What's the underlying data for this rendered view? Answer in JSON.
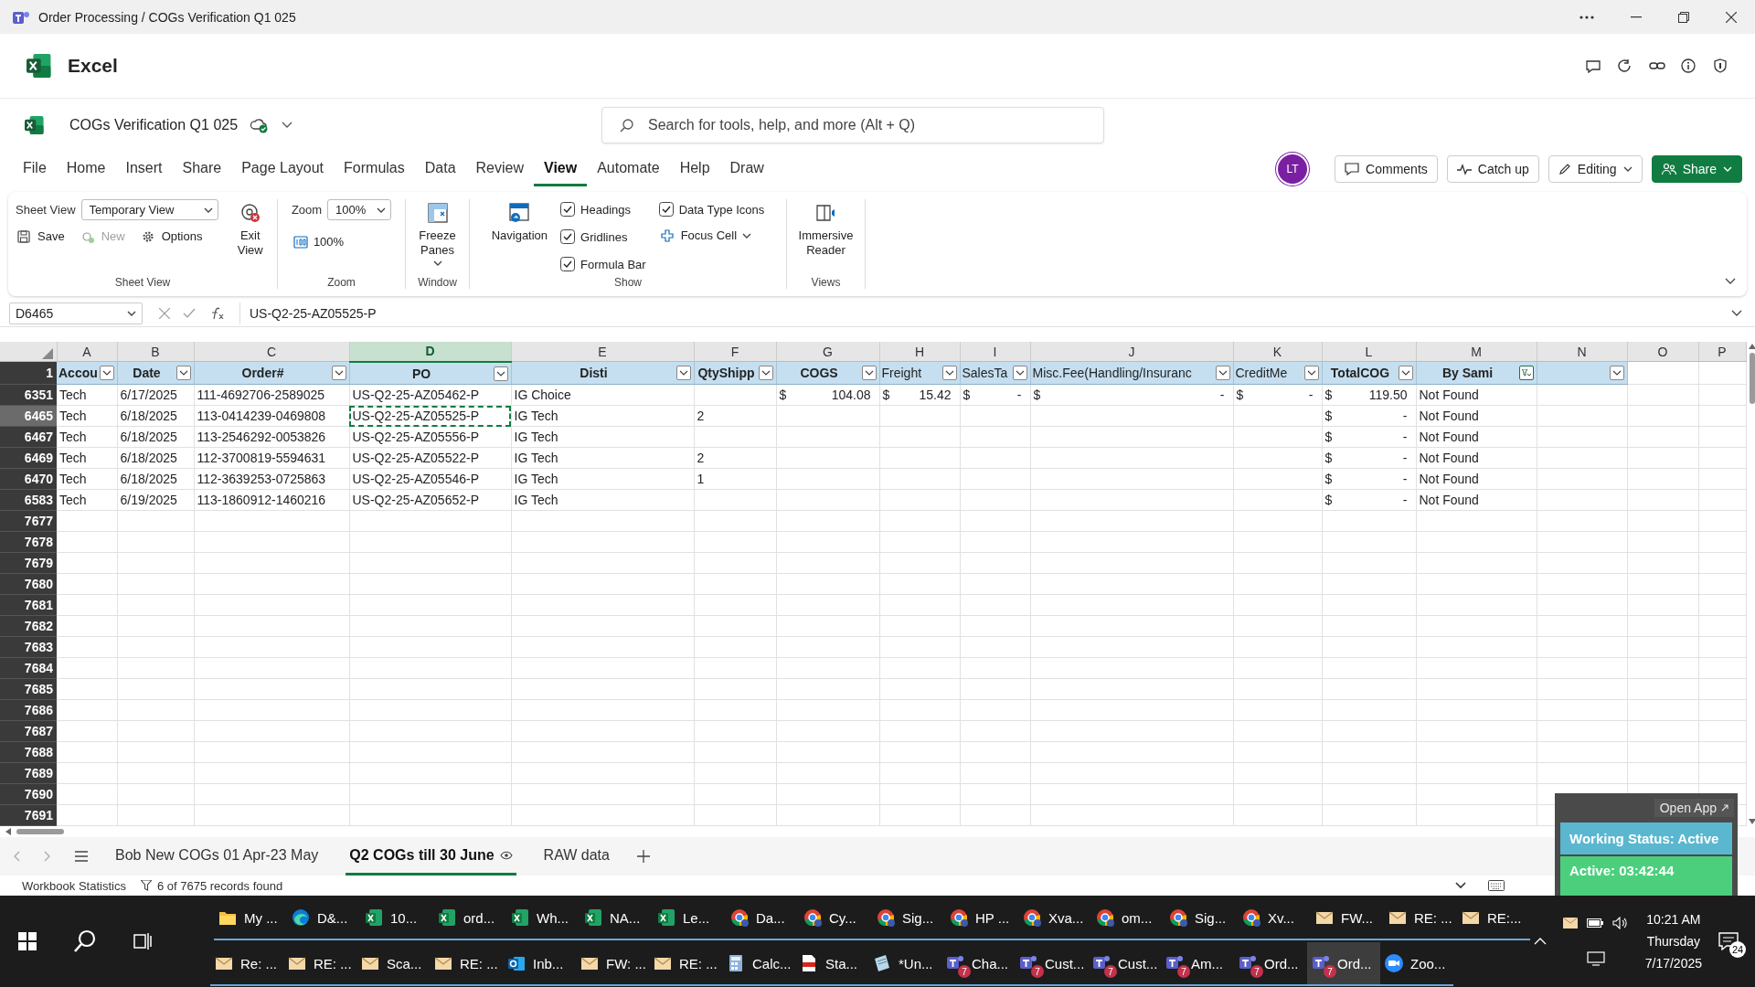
{
  "window": {
    "title": "Order Processing / COGs Verification Q1 025"
  },
  "app": {
    "name": "Excel"
  },
  "document": {
    "name": "COGs Verification Q1 025"
  },
  "search": {
    "placeholder": "Search for tools, help, and more (Alt + Q)"
  },
  "menu_tabs": [
    {
      "label": "File",
      "selected": false
    },
    {
      "label": "Home",
      "selected": false
    },
    {
      "label": "Insert",
      "selected": false
    },
    {
      "label": "Share",
      "selected": false
    },
    {
      "label": "Page Layout",
      "selected": false
    },
    {
      "label": "Formulas",
      "selected": false
    },
    {
      "label": "Data",
      "selected": false
    },
    {
      "label": "Review",
      "selected": false
    },
    {
      "label": "View",
      "selected": true
    },
    {
      "label": "Automate",
      "selected": false
    },
    {
      "label": "Help",
      "selected": false
    },
    {
      "label": "Draw",
      "selected": false
    }
  ],
  "avatar": {
    "initials": "LT"
  },
  "header_buttons": [
    {
      "label": "Comments",
      "kind": "plain"
    },
    {
      "label": "Catch up",
      "kind": "plain"
    },
    {
      "label": "Editing",
      "kind": "menu"
    },
    {
      "label": "Share",
      "kind": "primary"
    }
  ],
  "ribbon": {
    "groups": [
      {
        "label": "Sheet View",
        "columns": [
          [
            {
              "kind": "select",
              "label": "Sheet View",
              "value": "Temporary View"
            },
            {
              "kind": "row",
              "items": [
                {
                  "label": "Save",
                  "disabled": false
                },
                {
                  "label": "New",
                  "disabled": true
                },
                {
                  "label": "Options",
                  "disabled": false
                }
              ]
            }
          ],
          [
            {
              "kind": "big",
              "label": "Exit View",
              "menu": false
            }
          ]
        ]
      },
      {
        "label": "Zoom",
        "columns": [
          [
            {
              "kind": "select",
              "label": "Zoom",
              "value": "100%"
            },
            {
              "kind": "small",
              "label": "100%",
              "disabled": false,
              "menu": false
            }
          ]
        ]
      },
      {
        "label": "Window",
        "columns": [
          [
            {
              "kind": "big",
              "label": "Freeze Panes",
              "menu": true
            }
          ]
        ]
      },
      {
        "label": "Show",
        "columns": [
          [
            {
              "kind": "big",
              "label": "Navigation",
              "menu": false
            }
          ],
          [
            {
              "kind": "check",
              "label": "Headings",
              "checked": true
            },
            {
              "kind": "check",
              "label": "Gridlines",
              "checked": true
            },
            {
              "kind": "check",
              "label": "Formula Bar",
              "checked": true
            }
          ],
          [
            {
              "kind": "check",
              "label": "Data Type Icons",
              "checked": true
            },
            {
              "kind": "small",
              "label": "Focus Cell",
              "disabled": false,
              "menu": true
            }
          ]
        ]
      },
      {
        "label": "Views",
        "columns": [
          [
            {
              "kind": "big",
              "label": "Immersive Reader",
              "menu": false
            }
          ]
        ]
      }
    ]
  },
  "formula_bar": {
    "name_box": "D6465",
    "value": "US-Q2-25-AZ05525-P"
  },
  "grid": {
    "columns": [
      {
        "letter": "A",
        "selected": false
      },
      {
        "letter": "B",
        "selected": false
      },
      {
        "letter": "C",
        "selected": false
      },
      {
        "letter": "D",
        "selected": true
      },
      {
        "letter": "E",
        "selected": false
      },
      {
        "letter": "F",
        "selected": false
      },
      {
        "letter": "G",
        "selected": false
      },
      {
        "letter": "H",
        "selected": false
      },
      {
        "letter": "I",
        "selected": false
      },
      {
        "letter": "J",
        "selected": false
      },
      {
        "letter": "K",
        "selected": false
      },
      {
        "letter": "L",
        "selected": false
      },
      {
        "letter": "M",
        "selected": false
      },
      {
        "letter": "N",
        "selected": false
      },
      {
        "letter": "O",
        "selected": false
      },
      {
        "letter": "P",
        "selected": false
      }
    ],
    "header_row": {
      "number": "1",
      "cells": [
        {
          "label": "Accou",
          "filtered": false
        },
        {
          "label": "Date",
          "filtered": false
        },
        {
          "label": "Order#",
          "filtered": false
        },
        {
          "label": "PO",
          "filtered": false
        },
        {
          "label": "Disti",
          "filtered": false
        },
        {
          "label": "QtyShipp",
          "filtered": false
        },
        {
          "label": "COGS",
          "filtered": false
        },
        {
          "label": "Freight",
          "filtered": false
        },
        {
          "label": "SalesTa",
          "filtered": false
        },
        {
          "label": "Misc.Fee(Handling/Insuranc",
          "filtered": false
        },
        {
          "label": "CreditMe",
          "filtered": false
        },
        {
          "label": "TotalCOG",
          "filtered": false
        },
        {
          "label": "By Sami",
          "filtered": true
        },
        {
          "filtered": false
        }
      ]
    },
    "rows": [
      {
        "number": "6351",
        "selected": false,
        "cells": {
          "A": "Tech",
          "B": "6/17/2025",
          "C": "111-4692706-2589025",
          "D": "US-Q2-25-AZ05462-P",
          "E": "IG Choice",
          "G": {
            "currency": "$",
            "amount": "104.08"
          },
          "H": {
            "currency": "$",
            "amount": "15.42"
          },
          "I": {
            "currency": "$",
            "amount": "-"
          },
          "J": {
            "currency": "$",
            "amount": "-"
          },
          "K": {
            "currency": "$",
            "amount": "-"
          },
          "L": {
            "currency": "$",
            "amount": "119.50"
          },
          "M": "Not Found"
        }
      },
      {
        "number": "6465",
        "selected": true,
        "cells": {
          "A": "Tech",
          "B": "6/18/2025",
          "C": "113-0414239-0469808",
          "D": "US-Q2-25-AZ05525-P",
          "E": "IG Tech",
          "F": "2",
          "L": {
            "currency": "$",
            "amount": "-"
          },
          "M": "Not Found"
        }
      },
      {
        "number": "6467",
        "selected": false,
        "cells": {
          "A": "Tech",
          "B": "6/18/2025",
          "C": "113-2546292-0053826",
          "D": "US-Q2-25-AZ05556-P",
          "E": "IG Tech",
          "L": {
            "currency": "$",
            "amount": "-"
          },
          "M": "Not Found"
        }
      },
      {
        "number": "6469",
        "selected": false,
        "cells": {
          "A": "Tech",
          "B": "6/18/2025",
          "C": "112-3700819-5594631",
          "D": "US-Q2-25-AZ05522-P",
          "E": "IG Tech",
          "F": "2",
          "L": {
            "currency": "$",
            "amount": "-"
          },
          "M": "Not Found"
        }
      },
      {
        "number": "6470",
        "selected": false,
        "cells": {
          "A": "Tech",
          "B": "6/18/2025",
          "C": "112-3639253-0725863",
          "D": "US-Q2-25-AZ05546-P",
          "E": "IG Tech",
          "F": "1",
          "L": {
            "currency": "$",
            "amount": "-"
          },
          "M": "Not Found"
        }
      },
      {
        "number": "6583",
        "selected": false,
        "cells": {
          "A": "Tech",
          "B": "6/19/2025",
          "C": "113-1860912-1460216",
          "D": "US-Q2-25-AZ05652-P",
          "E": "IG Tech",
          "L": {
            "currency": "$",
            "amount": "-"
          },
          "M": "Not Found"
        }
      },
      {
        "number": "7677",
        "selected": false,
        "cells": {}
      },
      {
        "number": "7678",
        "selected": false,
        "cells": {}
      },
      {
        "number": "7679",
        "selected": false,
        "cells": {}
      },
      {
        "number": "7680",
        "selected": false,
        "cells": {}
      },
      {
        "number": "7681",
        "selected": false,
        "cells": {}
      },
      {
        "number": "7682",
        "selected": false,
        "cells": {}
      },
      {
        "number": "7683",
        "selected": false,
        "cells": {}
      },
      {
        "number": "7684",
        "selected": false,
        "cells": {}
      },
      {
        "number": "7685",
        "selected": false,
        "cells": {}
      },
      {
        "number": "7686",
        "selected": false,
        "cells": {}
      },
      {
        "number": "7687",
        "selected": false,
        "cells": {}
      },
      {
        "number": "7688",
        "selected": false,
        "cells": {}
      },
      {
        "number": "7689",
        "selected": false,
        "cells": {}
      },
      {
        "number": "7690",
        "selected": false,
        "cells": {}
      },
      {
        "number": "7691",
        "selected": false,
        "cells": {}
      }
    ]
  },
  "sheet_tabs": [
    {
      "label": "Bob New COGs 01 Apr-23 May",
      "selected": false
    },
    {
      "label": "Q2 COGs till 30 June",
      "selected": true
    },
    {
      "label": "RAW data",
      "selected": false
    }
  ],
  "status_bar": {
    "statistics": "Workbook Statistics",
    "filter_count": "6 of 7675 records found"
  },
  "status_widget": {
    "open_app": "Open App",
    "status": "Working Status: Active",
    "timer": "Active: 03:42:44"
  },
  "taskbar": {
    "rows": [
      [
        {
          "kind": "folder",
          "label": "My ...",
          "selected": false
        },
        {
          "kind": "edge",
          "label": "D&...",
          "selected": false
        },
        {
          "kind": "excel",
          "label": "10...",
          "selected": false
        },
        {
          "kind": "excel",
          "label": "ord...",
          "selected": false
        },
        {
          "kind": "excel",
          "label": "Wh...",
          "selected": false
        },
        {
          "kind": "excel",
          "label": "NA...",
          "selected": false
        },
        {
          "kind": "excel",
          "label": "Le...",
          "selected": false
        },
        {
          "kind": "chrome",
          "label": "Da...",
          "selected": false
        },
        {
          "kind": "chrome",
          "label": "Cy...",
          "selected": false
        },
        {
          "kind": "chrome",
          "label": "Sig...",
          "selected": false
        },
        {
          "kind": "chrome",
          "label": "HP ...",
          "selected": false
        },
        {
          "kind": "chrome",
          "label": "Xva...",
          "selected": false
        },
        {
          "kind": "chrome",
          "label": "om...",
          "selected": false
        },
        {
          "kind": "chrome",
          "label": "Sig...",
          "selected": false
        },
        {
          "kind": "chrome",
          "label": "Xv...",
          "selected": false
        },
        {
          "kind": "mail",
          "label": "FW...",
          "selected": false
        },
        {
          "kind": "mail",
          "label": "RE: ...",
          "selected": false
        },
        {
          "kind": "mail",
          "label": "RE:...",
          "selected": false
        }
      ],
      [
        {
          "kind": "mail",
          "label": "Re: ...",
          "selected": false
        },
        {
          "kind": "mail",
          "label": "RE: ...",
          "selected": false
        },
        {
          "kind": "mail",
          "label": "Sca...",
          "selected": false
        },
        {
          "kind": "mail",
          "label": "RE: ...",
          "selected": false
        },
        {
          "kind": "outlook",
          "label": "Inb...",
          "selected": false
        },
        {
          "kind": "mail",
          "label": "FW: ...",
          "selected": false
        },
        {
          "kind": "mail",
          "label": "RE: ...",
          "selected": false
        },
        {
          "kind": "calc",
          "label": "Calc...",
          "selected": false
        },
        {
          "kind": "pdf",
          "label": "Sta...",
          "selected": false
        },
        {
          "kind": "app",
          "label": "*Un...",
          "selected": false
        },
        {
          "kind": "teams",
          "label": "Cha...",
          "badge": "7",
          "selected": false
        },
        {
          "kind": "teams",
          "label": "Cust...",
          "badge": "7",
          "selected": false
        },
        {
          "kind": "teams",
          "label": "Cust...",
          "badge": "7",
          "selected": false
        },
        {
          "kind": "teams",
          "label": "Am...",
          "badge": "7",
          "selected": false
        },
        {
          "kind": "teams",
          "label": "Ord...",
          "badge": "7",
          "selected": false
        },
        {
          "kind": "teams",
          "label": "Ord...",
          "badge": "7",
          "selected": true
        },
        {
          "kind": "zoom",
          "label": "Zoo...",
          "selected": false
        }
      ]
    ],
    "clock": {
      "time": "10:21 AM",
      "day": "Thursday",
      "date": "7/17/2025"
    },
    "notifications": {
      "count": "24"
    }
  }
}
